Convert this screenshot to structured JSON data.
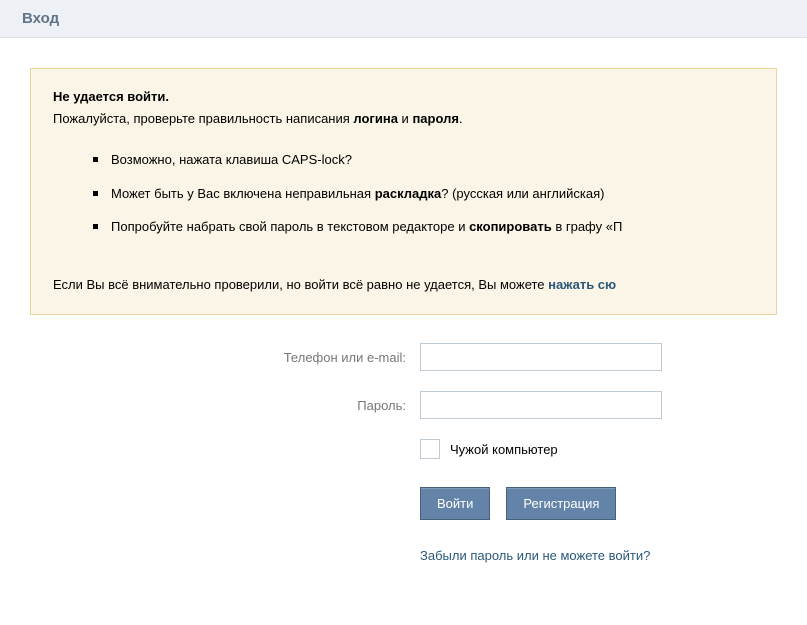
{
  "header": {
    "title": "Вход"
  },
  "error": {
    "title": "Не удается войти.",
    "subtitle_before": "Пожалуйста, проверьте правильность написания ",
    "subtitle_bold1": "логина",
    "subtitle_mid": " и ",
    "subtitle_bold2": "пароля",
    "subtitle_after": ".",
    "bullets": {
      "b1": "Возможно, нажата клавиша CAPS-lock?",
      "b2_before": "Может быть у Вас включена неправильная ",
      "b2_bold": "раскладка",
      "b2_after": "? (русская или английская)",
      "b3_before": "Попробуйте набрать свой пароль в текстовом редакторе и ",
      "b3_bold": "скопировать",
      "b3_after": " в графу «П"
    },
    "footer_text": "Если Вы всё внимательно проверили, но войти всё равно не удается, Вы можете ",
    "footer_link": "нажать сю"
  },
  "form": {
    "login_label": "Телефон или e-mail:",
    "password_label": "Пароль:",
    "checkbox_label": "Чужой компьютер",
    "submit_button": "Войти",
    "register_button": "Регистрация",
    "forgot_link": "Забыли пароль или не можете войти?"
  }
}
